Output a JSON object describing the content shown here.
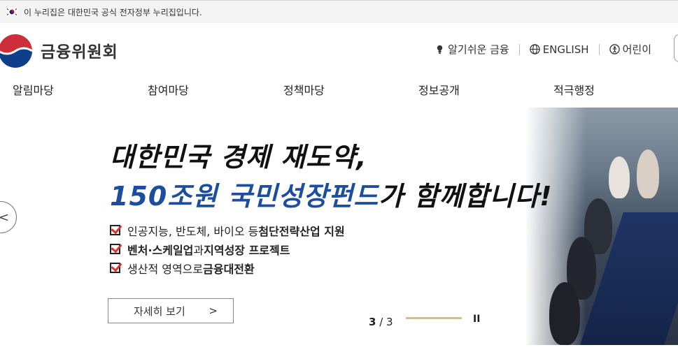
{
  "gov_banner": {
    "text": "이 누리집은 대한민국 공식 전자정부 누리집입니다."
  },
  "header": {
    "logo_text": "금융위원회",
    "util": [
      {
        "label": "알기쉬운 금융",
        "icon": "lightbulb-icon"
      },
      {
        "label": "ENGLISH",
        "icon": "globe-icon"
      },
      {
        "label": "어린이",
        "icon": "child-icon"
      }
    ]
  },
  "nav": [
    "알림마당",
    "참여마당",
    "정책마당",
    "정보공개",
    "적극행정"
  ],
  "hero": {
    "headline_line1": "대한민국 경제 재도약,",
    "headline_line2_blue": "150조원 국민성장펀드",
    "headline_line2_dark": "가 함께합니다!",
    "bullets": [
      {
        "normal": "인공지능, 반도체, 바이오 등 ",
        "bold": "첨단전략산업 지원"
      },
      {
        "bold_pre": "벤처·스케일업",
        "normal": "과 ",
        "bold": "지역성장 프로젝트"
      },
      {
        "normal": "생산적 영역으로 ",
        "bold": "금융대전환"
      }
    ],
    "more_label": "자세히 보기",
    "more_arrow": ">",
    "prev_label": "<",
    "pager_current": "3",
    "pager_sep": " / ",
    "pager_total": "3",
    "progress": 1.0,
    "pause_label": "II"
  },
  "colors": {
    "accent_blue": "#1d4d9e",
    "check_red": "#e0322b",
    "progress": "#c9c194"
  }
}
